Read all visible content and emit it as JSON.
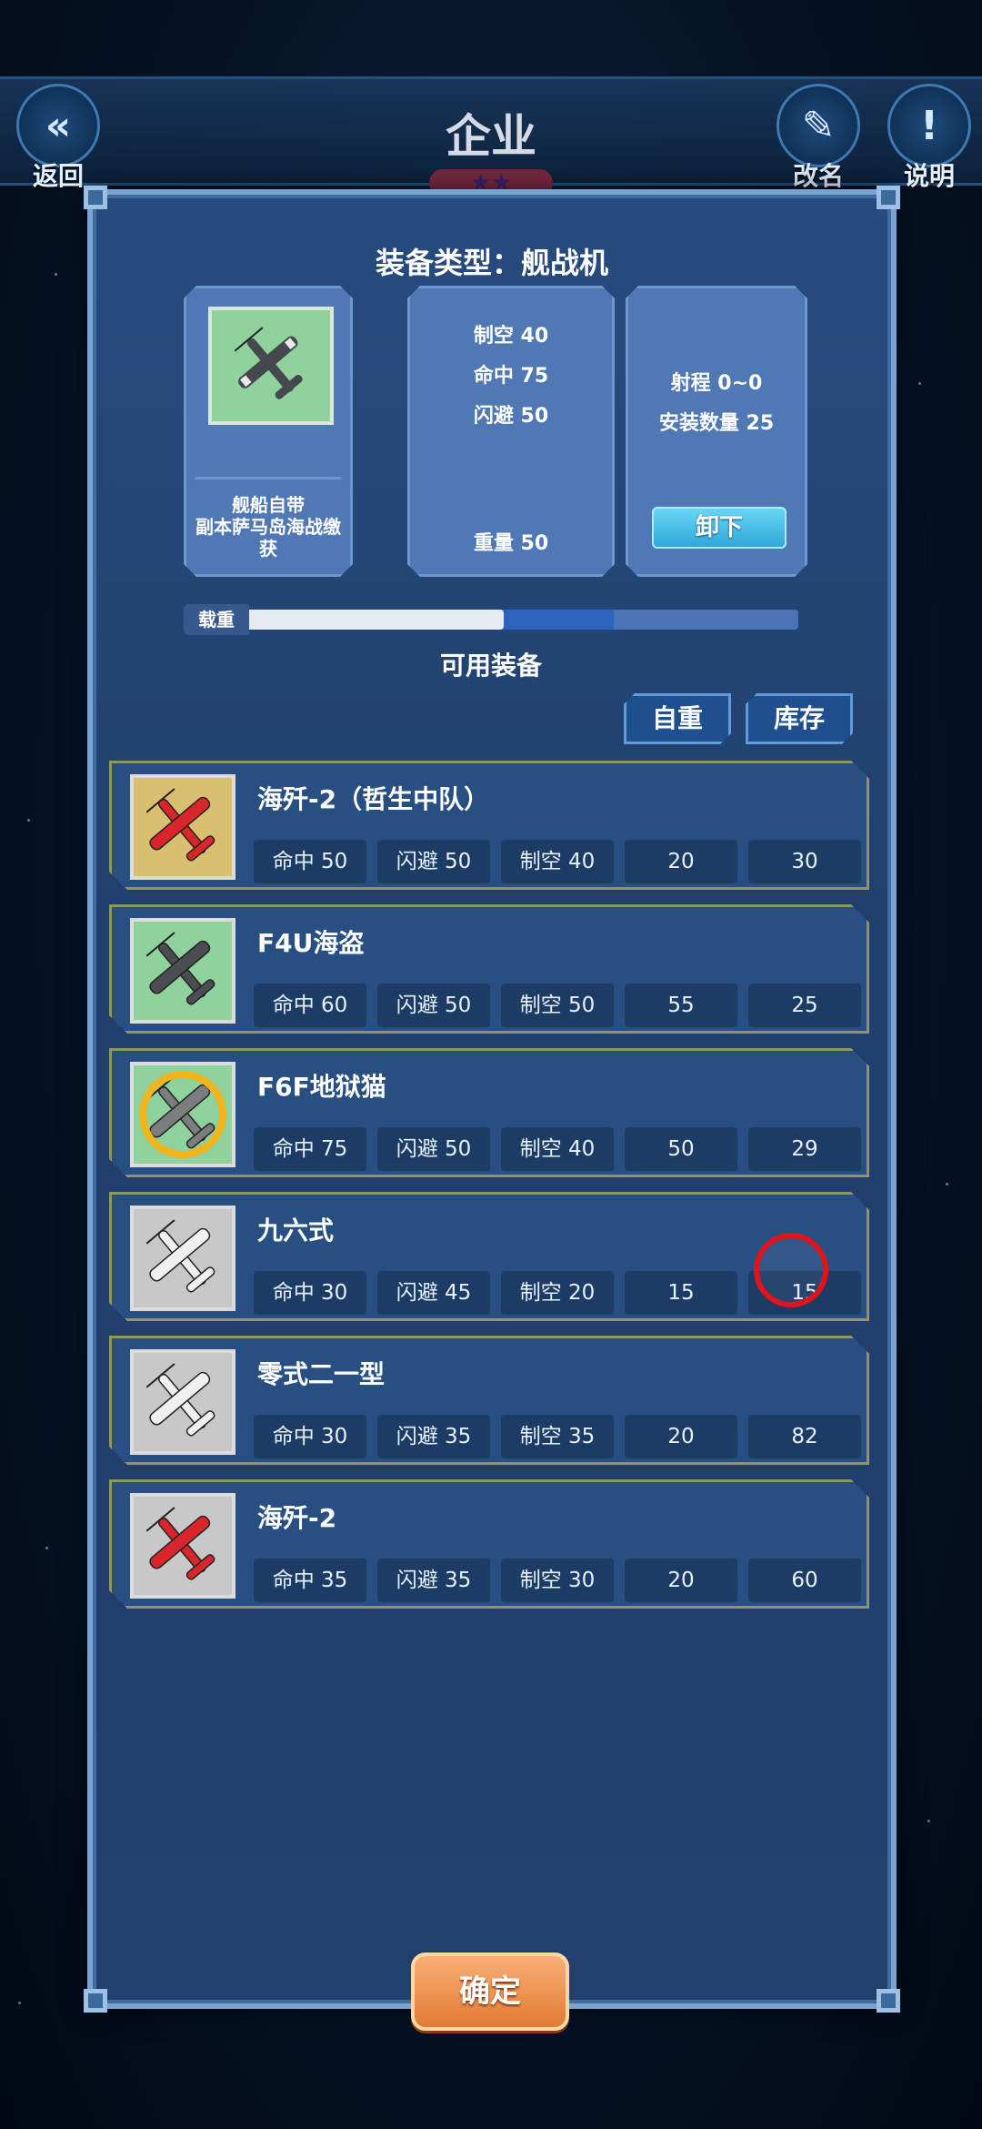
{
  "header": {
    "title": "企业",
    "back_label": "返回",
    "rename_label": "改名",
    "help_label": "说明",
    "stars": "★★"
  },
  "equipment": {
    "type_label": "装备类型：舰战机",
    "source_line1": "舰船自带",
    "source_line2": "副本萨马岛海战缴",
    "source_line3": "获",
    "stat_air": "制空 40",
    "stat_hit": "命中 75",
    "stat_evade": "闪避 50",
    "stat_weight": "重量 50",
    "stat_range": "射程 0~0",
    "stat_count": "安装数量 25",
    "unequip_label": "卸下"
  },
  "load": {
    "label": "载重",
    "used_fraction": 0.52,
    "preview_fraction": 0.7
  },
  "available": {
    "title": "可用装备",
    "tab_weight": "自重",
    "tab_stock": "库存",
    "items": [
      {
        "name": "海歼-2（哲生中队）",
        "hit": "命中 50",
        "evade": "闪避 50",
        "air": "制空 40",
        "weight": "20",
        "stock": "30",
        "thumb_color": "#d9c071",
        "plane_color": "#d8262a"
      },
      {
        "name": "F4U海盗",
        "hit": "命中 60",
        "evade": "闪避 50",
        "air": "制空 50",
        "weight": "55",
        "stock": "25",
        "thumb_color": "#8fd29e",
        "plane_color": "#4a4d52"
      },
      {
        "name": "F6F地狱猫",
        "hit": "命中 75",
        "evade": "闪避 50",
        "air": "制空 40",
        "weight": "50",
        "stock": "29",
        "thumb_color": "#8fd29e",
        "plane_color": "#7b7d7e"
      },
      {
        "name": "九六式",
        "hit": "命中 30",
        "evade": "闪避 45",
        "air": "制空 20",
        "weight": "15",
        "stock": "15",
        "thumb_color": "#c8c8c8",
        "plane_color": "#f0f0f0"
      },
      {
        "name": "零式二一型",
        "hit": "命中 30",
        "evade": "闪避 35",
        "air": "制空 35",
        "weight": "20",
        "stock": "82",
        "thumb_color": "#c8c8c8",
        "plane_color": "#f0f0f0"
      },
      {
        "name": "海歼-2",
        "hit": "命中 35",
        "evade": "闪避 35",
        "air": "制空 30",
        "weight": "20",
        "stock": "60",
        "thumb_color": "#c8c8c8",
        "plane_color": "#d8262a"
      }
    ]
  },
  "confirm_label": "确定"
}
